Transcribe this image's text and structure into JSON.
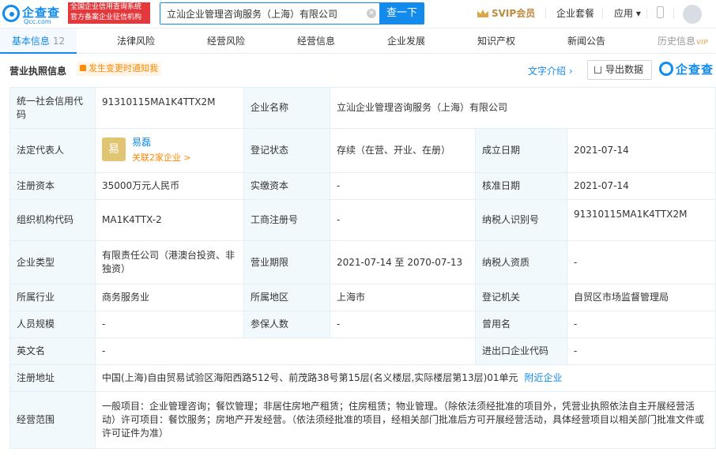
{
  "header": {
    "logo_name": "企查查",
    "logo_url": "Qcc.com",
    "badge_line1": "全国企业信用查询系统",
    "badge_line2": "官方备案企业征信机构",
    "search_value": "立汕企业管理咨询服务（上海）有限公司",
    "search_button": "查一下",
    "svip": "SVIP会员",
    "nav_package": "企业套餐",
    "nav_apps": "应用 ▾"
  },
  "tabs": [
    {
      "label": "基本信息",
      "count": "12"
    },
    {
      "label": "法律风险"
    },
    {
      "label": "经营风险"
    },
    {
      "label": "经营信息"
    },
    {
      "label": "企业发展"
    },
    {
      "label": "知识产权"
    },
    {
      "label": "新闻公告"
    },
    {
      "label": "历史信息",
      "vip": "VIP"
    }
  ],
  "section": {
    "title": "营业执照信息",
    "notice": "发生变更时通知我",
    "intro": "文字介绍 ›",
    "export": "导出数据",
    "brand": "企查查"
  },
  "info": {
    "credit_code_k": "统一社会信用代码",
    "credit_code_v": "91310115MA1K4TTX2M",
    "company_name_k": "企业名称",
    "company_name_v": "立汕企业管理咨询服务（上海）有限公司",
    "legal_rep_k": "法定代表人",
    "legal_rep_avatar": "易",
    "legal_rep_name": "易磊",
    "legal_rep_related": "关联2家企业 >",
    "reg_status_k": "登记状态",
    "reg_status_v": "存续（在营、开业、在册）",
    "est_date_k": "成立日期",
    "est_date_v": "2021-07-14",
    "reg_capital_k": "注册资本",
    "reg_capital_v": "35000万元人民币",
    "paid_capital_k": "实缴资本",
    "paid_capital_v": "-",
    "approve_date_k": "核准日期",
    "approve_date_v": "2021-07-14",
    "org_code_k": "组织机构代码",
    "org_code_v": "MA1K4TTX-2",
    "biz_reg_no_k": "工商注册号",
    "biz_reg_no_v": "-",
    "taxpayer_id_k": "纳税人识别号",
    "taxpayer_id_v": "91310115MA1K4TTX2M",
    "company_type_k": "企业类型",
    "company_type_v": "有限责任公司（港澳台投资、非独资）",
    "biz_term_k": "营业期限",
    "biz_term_v": "2021-07-14 至 2070-07-13",
    "taxpayer_q_k": "纳税人资质",
    "taxpayer_q_v": "-",
    "industry_k": "所属行业",
    "industry_v": "商务服务业",
    "region_k": "所属地区",
    "region_v": "上海市",
    "authority_k": "登记机关",
    "authority_v": "自贸区市场监督管理局",
    "staff_k": "人员规模",
    "staff_v": "-",
    "insured_k": "参保人数",
    "insured_v": "-",
    "former_name_k": "曾用名",
    "former_name_v": "-",
    "en_name_k": "英文名",
    "en_name_v": "-",
    "ie_code_k": "进出口企业代码",
    "ie_code_v": "-",
    "address_k": "注册地址",
    "address_v": "中国(上海)自由贸易试验区海阳西路512号、前茂路38号第15层(名义楼层,实际楼层第13层)01单元",
    "address_link": "附近企业",
    "scope_k": "经营范围",
    "scope_v": "一般项目：企业管理咨询；餐饮管理；非居住房地产租赁；住房租赁；物业管理。（除依法须经批准的项目外，凭营业执照依法自主开展经营活动）许可项目：餐饮服务；房地产开发经营。（依法须经批准的项目，经相关部门批准后方可开展经营活动，具体经营项目以相关部门批准文件或许可证件为准）"
  },
  "colors": {
    "accent": "#128bed",
    "orange": "#ff8900",
    "key_bg": "#f2f9fc",
    "border": "#e4eef6"
  }
}
